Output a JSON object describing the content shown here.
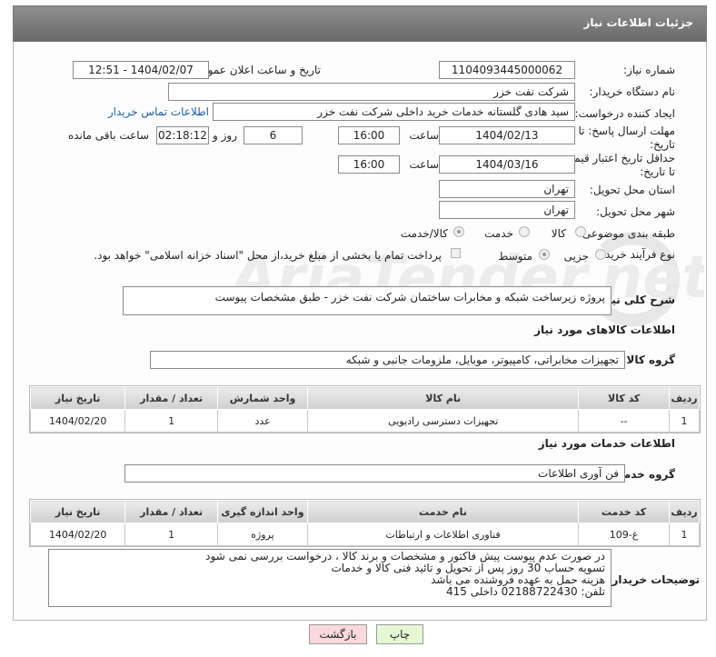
{
  "header": {
    "title": "جزئیات اطلاعات نیاز"
  },
  "form": {
    "need_number_label": "شماره نیاز:",
    "need_number": "1104093445000062",
    "announce_label": "تاریخ و ساعت اعلان عمومی:",
    "announce_value": "1404/02/07 - 12:51",
    "buyer_label": "نام دستگاه خریدار:",
    "buyer_value": "شرکت نفت خزر",
    "creator_label": "ایجاد کننده درخواست:",
    "creator_value": "سید هادی گلستانه خدمات خرید داخلی شرکت نفت خزر",
    "contact_link": "اطلاعات تماس خریدار",
    "send_deadline_label": "مهلت ارسال پاسخ: تا تاریخ:",
    "send_date": "1404/02/13",
    "time_label": "ساعت",
    "send_time": "16:00",
    "days_value": "6",
    "days_label": "روز و",
    "remaining_time": "02:18:12",
    "remaining_label": "ساعت باقی مانده",
    "validity_label": "حداقل تاریخ اعتبار قیمت: تا تاریخ:",
    "validity_date": "1404/03/16",
    "validity_time": "16:00",
    "province_label": "استان محل تحویل:",
    "province_value": "تهران",
    "city_label": "شهر محل تحویل:",
    "city_value": "تهران",
    "category_label": "طبقه بندی موضوعی:",
    "category_options": [
      "کالا",
      "خدمت",
      "کالا/خدمت"
    ],
    "category_selected": "کالا/خدمت",
    "process_label": "نوع فرآیند خرید :",
    "process_options": [
      "جزیی",
      "متوسط"
    ],
    "process_selected": "متوسط",
    "payment_note": "پرداخت تمام یا بخشی از مبلغ خرید،از محل \"اسناد خزانه اسلامی\" خواهد بود."
  },
  "description": {
    "label": "شرح کلی نیاز:",
    "value": "پروژه زیرساخت شبکه و مخابرات ساختمان شرکت نفت خزر - طبق مشخصات پیوست"
  },
  "goods": {
    "section_title": "اطلاعات کالاهای مورد نیاز",
    "group_label": "گروه کالا:",
    "group_value": "تجهیزات مخابراتی، کامپیوتر، موبایل، ملزومات جانبی و شبکه",
    "columns": [
      "ردیف",
      "کد کالا",
      "نام کالا",
      "واحد شمارش",
      "تعداد / مقدار",
      "تاریخ نیاز"
    ],
    "rows": [
      [
        "1",
        "--",
        "تجهیزات دسترسی رادیویی",
        "عدد",
        "1",
        "1404/02/20"
      ]
    ]
  },
  "services": {
    "section_title": "اطلاعات خدمات مورد نیاز",
    "group_label": "گروه خدمت:",
    "group_value": "فن آوری اطلاعات",
    "columns": [
      "ردیف",
      "کد خدمت",
      "نام خدمت",
      "واحد اندازه گیری",
      "تعداد / مقدار",
      "تاریخ نیاز"
    ],
    "rows": [
      [
        "1",
        "غ-109",
        "فناوری اطلاعات و ارتباطات",
        "پروژه",
        "1",
        "1404/02/20"
      ]
    ]
  },
  "buyer_notes": {
    "label": "توضیحات خریدار:",
    "lines": [
      "در صورت عدم پیوست پیش فاکتور و مشخصات و برند کالا ، درخواست بررسی نمی شود",
      "تسویه حساب 30 روز پس از تحویل و تائید فنی کالا و خدمات",
      "هزینه حمل به عهده فروشنده می باشد",
      "تلفن: 02188722430 داخلی 415"
    ]
  },
  "buttons": {
    "print": "چاپ",
    "back": "بازگشت"
  },
  "watermark": {
    "text": "AriaTender.net"
  },
  "colors": {
    "header_bg": "#7d7d7d",
    "link": "#1a5fb4",
    "print_bg": "#e6f7d6",
    "back_bg": "#f9d9dd"
  }
}
